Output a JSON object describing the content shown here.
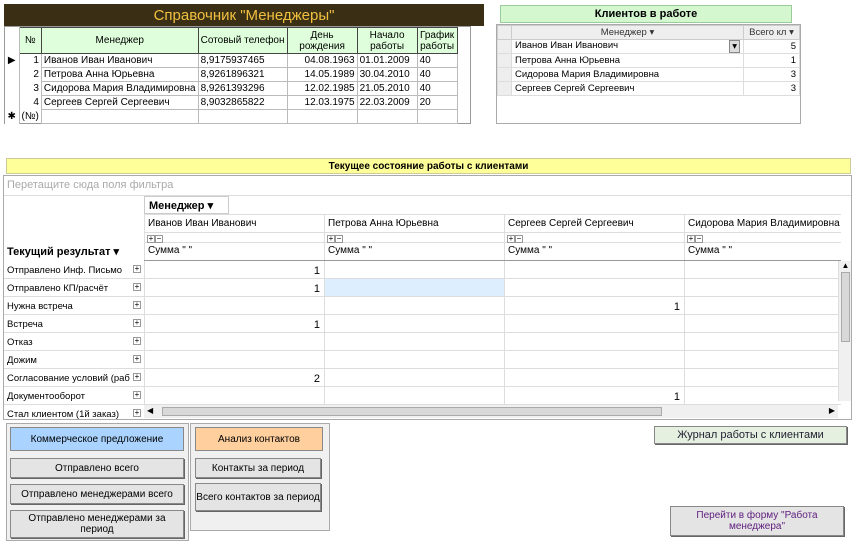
{
  "managers_title": "Справочник \"Менеджеры\"",
  "grid_headers": [
    "№",
    "Менеджер",
    "Сотовый телефон",
    "День рождения",
    "Начало работы",
    "График работы"
  ],
  "grid_rows": [
    [
      "1",
      "Иванов Иван Иванович",
      "8,9175937465",
      "04.08.1963",
      "01.01.2009",
      "40"
    ],
    [
      "2",
      "Петрова Анна Юрьевна",
      "8,9261896321",
      "14.05.1989",
      "30.04.2010",
      "40"
    ],
    [
      "3",
      "Сидорова Мария Владимировна",
      "8,9261393296",
      "12.02.1985",
      "21.05.2010",
      "40"
    ],
    [
      "4",
      "Сергеев Сергей Сергеевич",
      "8,9032865822",
      "12.03.1975",
      "22.03.2009",
      "20"
    ]
  ],
  "new_row_marker": "(№)",
  "clients_title": "Клиентов в работе",
  "clients_headers": [
    "Менеджер",
    "Всего кл"
  ],
  "clients_rows": [
    [
      "Иванов Иван Иванович",
      "5"
    ],
    [
      "Петрова Анна Юрьевна",
      "1"
    ],
    [
      "Сидорова Мария Владимировна",
      "3"
    ],
    [
      "Сергеев Сергей Сергеевич",
      "3"
    ]
  ],
  "status_title": "Текущее состояние работы с клиентами",
  "filter_placeholder": "Перетащите сюда поля фильтра",
  "pivot_column_field": "Менеджер",
  "pivot_row_field": "Текущий результат",
  "pivot_columns": [
    "Иванов Иван Иванович",
    "Петрова Анна Юрьевна",
    "Сергеев Сергей Сергеевич",
    "Сидорова Мария Владимировна"
  ],
  "sum_label": "Сумма \" \"",
  "pivot_rows": [
    {
      "label": "Отправлено Инф. Письмо",
      "values": [
        "1",
        "",
        "",
        ""
      ]
    },
    {
      "label": "Отправлено КП/расчёт",
      "values": [
        "1",
        "",
        "",
        ""
      ]
    },
    {
      "label": "Нужна встреча",
      "values": [
        "",
        "",
        "1",
        ""
      ]
    },
    {
      "label": "Встреча",
      "values": [
        "1",
        "",
        "",
        ""
      ]
    },
    {
      "label": "Отказ",
      "values": [
        "",
        "",
        "",
        ""
      ]
    },
    {
      "label": "Дожим",
      "values": [
        "",
        "",
        "",
        ""
      ]
    },
    {
      "label": "Согласование условий (раб",
      "values": [
        "2",
        "",
        "",
        ""
      ]
    },
    {
      "label": "Документооборот",
      "values": [
        "",
        "",
        "1",
        ""
      ]
    },
    {
      "label": "Стал клиентом (1й заказ)",
      "values": [
        "",
        "",
        "",
        ""
      ]
    }
  ],
  "panel_left_title": "Коммерческое предложение",
  "btn_sent_total": "Отправлено всего",
  "btn_sent_by_managers": "Отправлено менеджерами всего",
  "btn_sent_by_managers_period": "Отправлено менеджерами за период",
  "panel_right_title": "Анализ контактов",
  "btn_contacts_period": "Контакты за период",
  "btn_contacts_total": "Всего контактов за период",
  "btn_journal": "Журнал работы с клиентами",
  "btn_goto_form": "Перейти в форму \"Работа менеджера\""
}
